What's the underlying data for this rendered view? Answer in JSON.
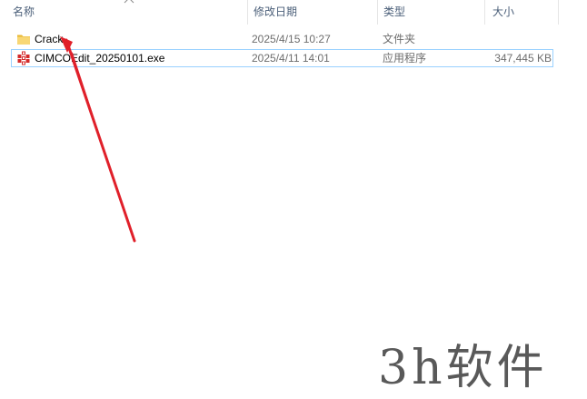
{
  "columns": {
    "name": "名称",
    "date": "修改日期",
    "type": "类型",
    "size": "大小"
  },
  "files": [
    {
      "name": "Crack",
      "date": "2025/4/15 10:27",
      "type": "文件夹",
      "size": "",
      "icon": "folder-icon"
    },
    {
      "name": "CIMCOEdit_20250101.exe",
      "date": "2025/4/11 14:01",
      "type": "应用程序",
      "size": "347,445 KB",
      "icon": "cimco-app-icon"
    }
  ],
  "watermark": "3h软件",
  "colors": {
    "header_text": "#4c607a",
    "selection_border": "#99d1ff",
    "folder": "#f4c645",
    "arrow": "#e0202a"
  }
}
